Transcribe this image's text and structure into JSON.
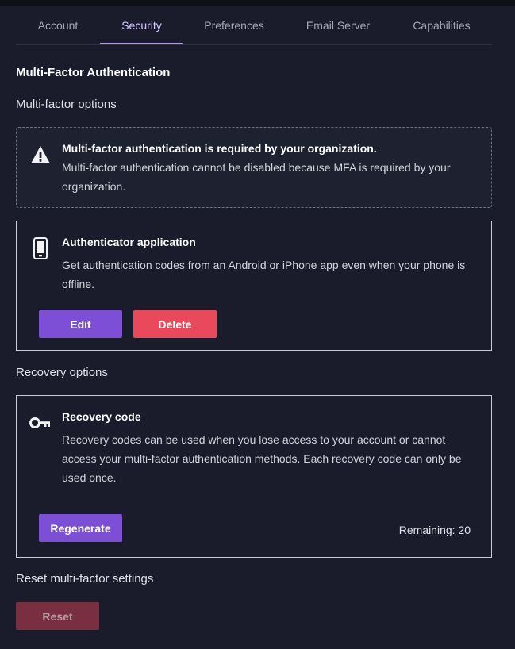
{
  "tabs": [
    {
      "label": "Account",
      "active": false
    },
    {
      "label": "Security",
      "active": true
    },
    {
      "label": "Preferences",
      "active": false
    },
    {
      "label": "Email Server",
      "active": false
    },
    {
      "label": "Capabilities",
      "active": false
    }
  ],
  "page_title": "Multi-Factor Authentication",
  "mfa_section_title": "Multi-factor options",
  "notice": {
    "icon": "warning-icon",
    "title": "Multi-factor authentication is required by your organization.",
    "text": "Multi-factor authentication cannot be disabled because MFA is required by your organization."
  },
  "authenticator": {
    "icon": "phone-icon",
    "title": "Authenticator application",
    "text": "Get authentication codes from an Android or iPhone app even when your phone is offline.",
    "edit_label": "Edit",
    "delete_label": "Delete"
  },
  "recovery_section_title": "Recovery options",
  "recovery": {
    "icon": "key-icon",
    "title": "Recovery code",
    "text": "Recovery codes can be used when you lose access to your account or cannot access your multi-factor authentication methods. Each recovery code can only be used once.",
    "regenerate_label": "Regenerate",
    "remaining": "Remaining: 20"
  },
  "reset_section_title": "Reset multi-factor settings",
  "reset_label": "Reset",
  "colors": {
    "background": "#1a1c2c",
    "accent": "#7d4fd6",
    "danger": "#e9495a",
    "active_tab": "#b39ddb"
  }
}
